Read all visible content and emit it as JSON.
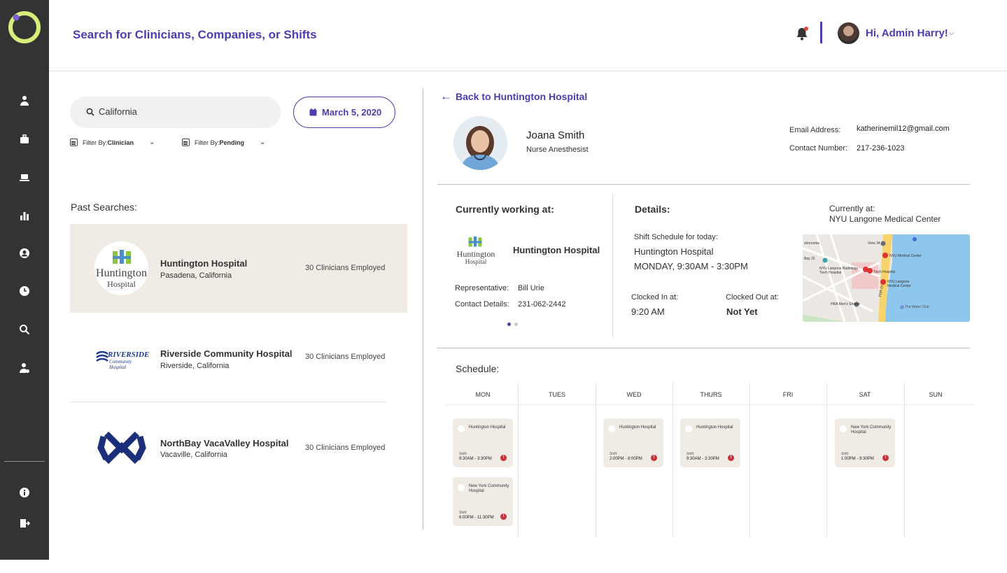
{
  "header": {
    "title": "Search for Clinicians, Companies, or Shifts",
    "greeting": "Hi, Admin Harry!"
  },
  "search": {
    "value": "California",
    "date": "March 5, 2020",
    "filters": [
      {
        "prefix": "Filter By: ",
        "value": "Clinician"
      },
      {
        "prefix": "Filter By: ",
        "value": "Pending"
      }
    ]
  },
  "past_searches": {
    "label": "Past Searches:",
    "items": [
      {
        "name": "Huntington Hospital",
        "location": "Pasadena, California",
        "count": "30 Clinicians Employed"
      },
      {
        "name": "Riverside Community Hospital",
        "location": "Riverside, California",
        "count": "30 Clinicians Employed"
      },
      {
        "name": "NorthBay VacaValley Hospital",
        "location": "Vacaville, California",
        "count": "30 Clinicians Employed"
      }
    ]
  },
  "logos": {
    "huntington_1": "Huntington",
    "huntington_2": "Hospital",
    "riverside_1": "RIVERSIDE",
    "riverside_2": "Community Hospital"
  },
  "detail": {
    "back_label": "Back to Huntington Hospital",
    "name": "Joana Smith",
    "role": "Nurse Anesthesist",
    "email_label": "Email Address:",
    "email": "katherinemil12@gmail.com",
    "phone_label": "Contact Number:",
    "phone": "217-236-1023",
    "working_title": "Currently working at:",
    "working_hospital": "Huntington Hospital",
    "rep_label": "Representative:",
    "rep_value": "Bill Urie",
    "contact_label": "Contact Details:",
    "contact_value": "231-062-2442",
    "details_title": "Details:",
    "schedule_today_label": "Shift Schedule for today:",
    "schedule_today_hospital": "Huntington Hospital",
    "schedule_today_time": "MONDAY, 9:30AM - 3:30PM",
    "clock_in_label": "Clocked In at:",
    "clock_in_value": "9:20 AM",
    "clock_out_label": "Clocked Out at:",
    "clock_out_value": "Not Yet",
    "current_label": "Currently at:",
    "current_value": "NYU Langone Medical Center"
  },
  "map_labels": {
    "a": "NYU Medical Center",
    "b": "Tisch Hospital",
    "c": "NYU Langone Radiology - Tisch Hospital",
    "d": "NYU Langone Medical Center",
    "e": "HRA Men's Shelter",
    "f": "The Water Club",
    "g": "View 34",
    "h": "Bay 15",
    "i": "stronomia",
    "j": "FDR Dr"
  },
  "schedule": {
    "title": "Schedule:",
    "days": [
      "MON",
      "TUES",
      "WED",
      "THURS",
      "FRI",
      "SAT",
      "SUN"
    ],
    "shift_label": "Shift:",
    "shifts": [
      {
        "hospital": "Huntington Hospital",
        "time": "9:30AM - 3:30PM"
      },
      {
        "hospital": "New York Community Hospital",
        "time": "6:00PM - 11:30PM"
      },
      {
        "hospital": "Huntington Hospital",
        "time": "2:00PM - 8:00PM"
      },
      {
        "hospital": "Huntington Hospital",
        "time": "9:30AM - 3:30PM"
      },
      {
        "hospital": "New York Community Hospital",
        "time": "1:00PM - 9:30PM"
      }
    ]
  },
  "colors": {
    "accent": "#4b3fb0",
    "sidebar": "#333333",
    "card": "#f1ebe6",
    "alert": "#c8323a",
    "logo_green": "#d6ef7a"
  }
}
